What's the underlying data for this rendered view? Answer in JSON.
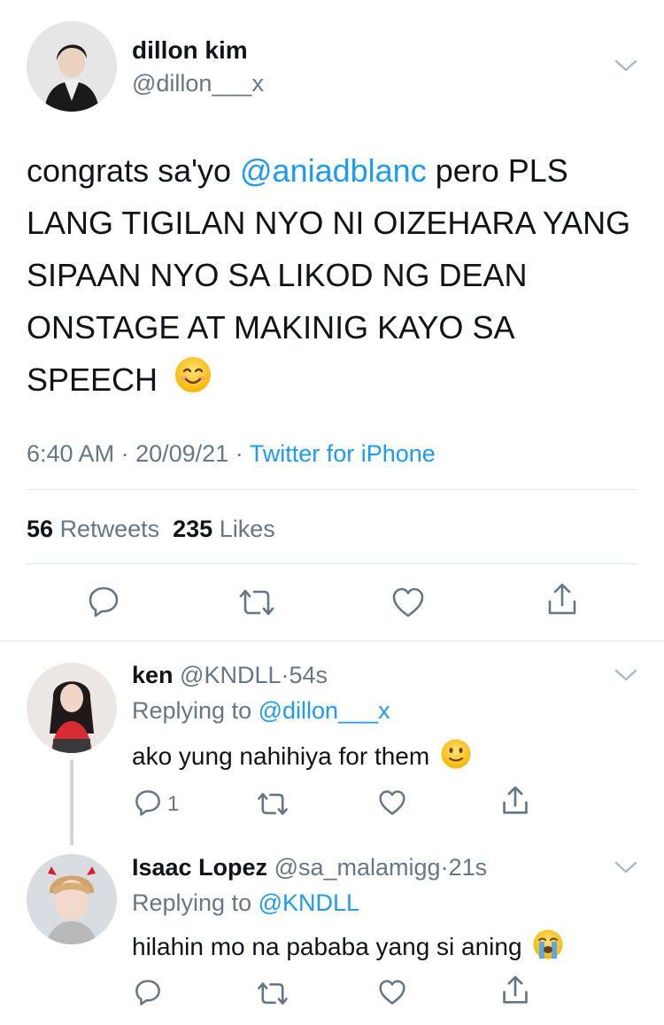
{
  "main_tweet": {
    "display_name": "dillon kim",
    "handle": "@dillon___x",
    "text_parts": {
      "pre": "congrats sa'yo ",
      "mention": "@aniadblanc",
      "post": " pero PLS LANG TIGILAN NYO NI OIZEHARA YANG SIPAAN NYO SA LIKOD NG DEAN ONSTAGE AT MAKINIG KAYO SA SPEECH"
    },
    "emoji": "smiling-face-with-smiling-eyes",
    "time": "6:40 AM",
    "date": "20/09/21",
    "separator": "·",
    "source": "Twitter for iPhone",
    "retweets_count": "56",
    "retweets_label": "Retweets",
    "likes_count": "235",
    "likes_label": "Likes"
  },
  "replies": [
    {
      "display_name": "ken",
      "handle": "@KNDLL",
      "time": "54s",
      "replying_prefix": "Replying to",
      "replying_to": "@dillon___x",
      "text": "ako yung nahihiya for them",
      "emoji": "slightly-smiling-face",
      "reply_count": "1"
    },
    {
      "display_name": "Isaac Lopez",
      "handle": "@sa_malamigg",
      "time": "21s",
      "replying_prefix": "Replying to",
      "replying_to": "@KNDLL",
      "text": "hilahin mo na pababa yang si aning",
      "emoji": "loudly-crying-face",
      "reply_count": ""
    }
  ],
  "colors": {
    "link": "#1d9bf0",
    "muted": "#657786",
    "icon": "#657786",
    "divider": "#e1e8ed"
  }
}
